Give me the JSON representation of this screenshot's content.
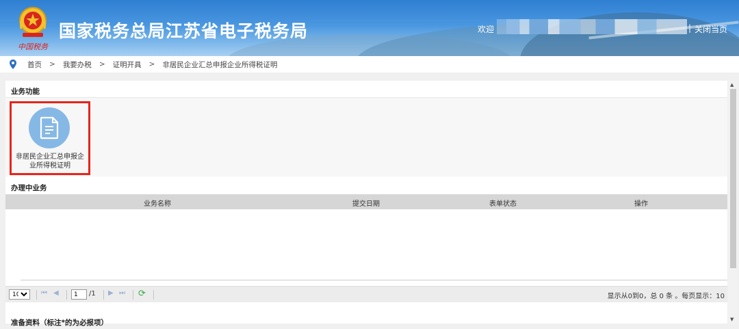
{
  "header": {
    "site_title": "国家税务总局江苏省电子税务局",
    "slogan": "中国税务",
    "welcome_label": "欢迎",
    "separator": "|",
    "close_page_label": "关闭当页"
  },
  "breadcrumb": {
    "items": [
      "首页",
      "我要办税",
      "证明开具",
      "非居民企业汇总申报企业所得税证明"
    ],
    "arrow": ">"
  },
  "business_functions": {
    "title": "业务功能",
    "tiles": [
      {
        "label": "非居民企业汇总申报企业所得税证明",
        "icon": "document-icon"
      }
    ]
  },
  "in_progress": {
    "title": "办理中业务",
    "columns": [
      "业务名称",
      "提交日期",
      "表单状态",
      "操作"
    ],
    "rows": []
  },
  "pager": {
    "page_size": "10",
    "current_page": "1",
    "total_pages": "/1",
    "info": "显示从0到0，总 0 条 。每页显示：10"
  },
  "next_section": {
    "title": "准备资料（标注*的为必报项）"
  },
  "colors": {
    "header_blue": "#2f7fd2",
    "highlight_red": "#e8241a",
    "icon_circle": "#86b8e6"
  }
}
